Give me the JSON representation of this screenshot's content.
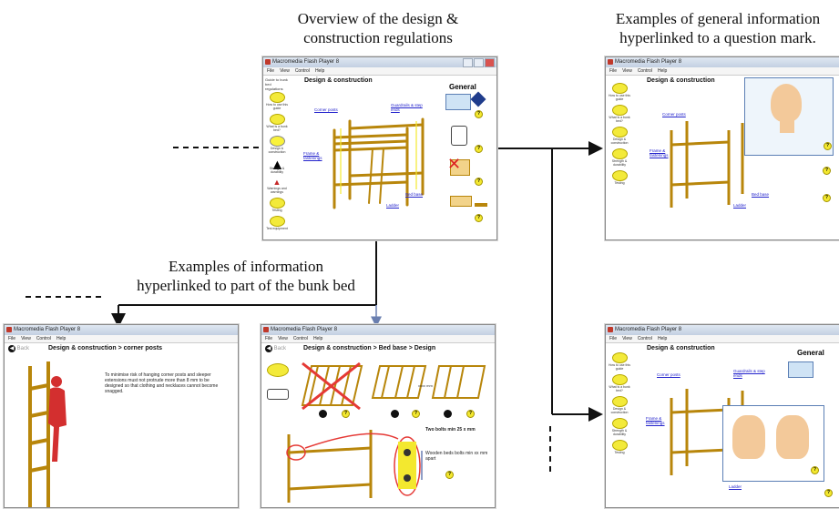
{
  "captions": {
    "overview": [
      "Overview of the design &",
      "construction regulations"
    ],
    "general": [
      "Examples of general information",
      "hyperlinked to a question mark."
    ],
    "part": [
      "Examples of information",
      "hyperlinked to part of the bunk bed"
    ]
  },
  "window": {
    "title": "Macromedia Flash Player 8",
    "menu": [
      "File",
      "View",
      "Control",
      "Help"
    ]
  },
  "overview_page": {
    "heading": "Design & construction",
    "general": "General",
    "links": [
      "Corner posts",
      "Guardrails & step ends",
      "Frame & fastenings",
      "Bed base",
      "Ladder"
    ],
    "sidebar": [
      "Guide to bunk bed regulations",
      "How to use this guide",
      "What is a bunk bed?",
      "Design & construction",
      "Strength & durability",
      "Warnings and warnings",
      "Testing",
      "Test equipment"
    ]
  },
  "corner_page": {
    "back": "Back",
    "heading": "Design & construction > corner posts",
    "text": "To minimise risk of hanging corner posts and sleeper extensions must not protrude more than 8 mm to be designed so that clothing and necklaces cannot become snagged."
  },
  "bedbase_page": {
    "back": "Back",
    "heading": "Design & construction > Bed base > Design",
    "label_twobolts": "Two bolts min 25 x mm",
    "label_wooden": "Wooden beds bolts min xx mm apart",
    "xxx": "xxxx mm"
  }
}
